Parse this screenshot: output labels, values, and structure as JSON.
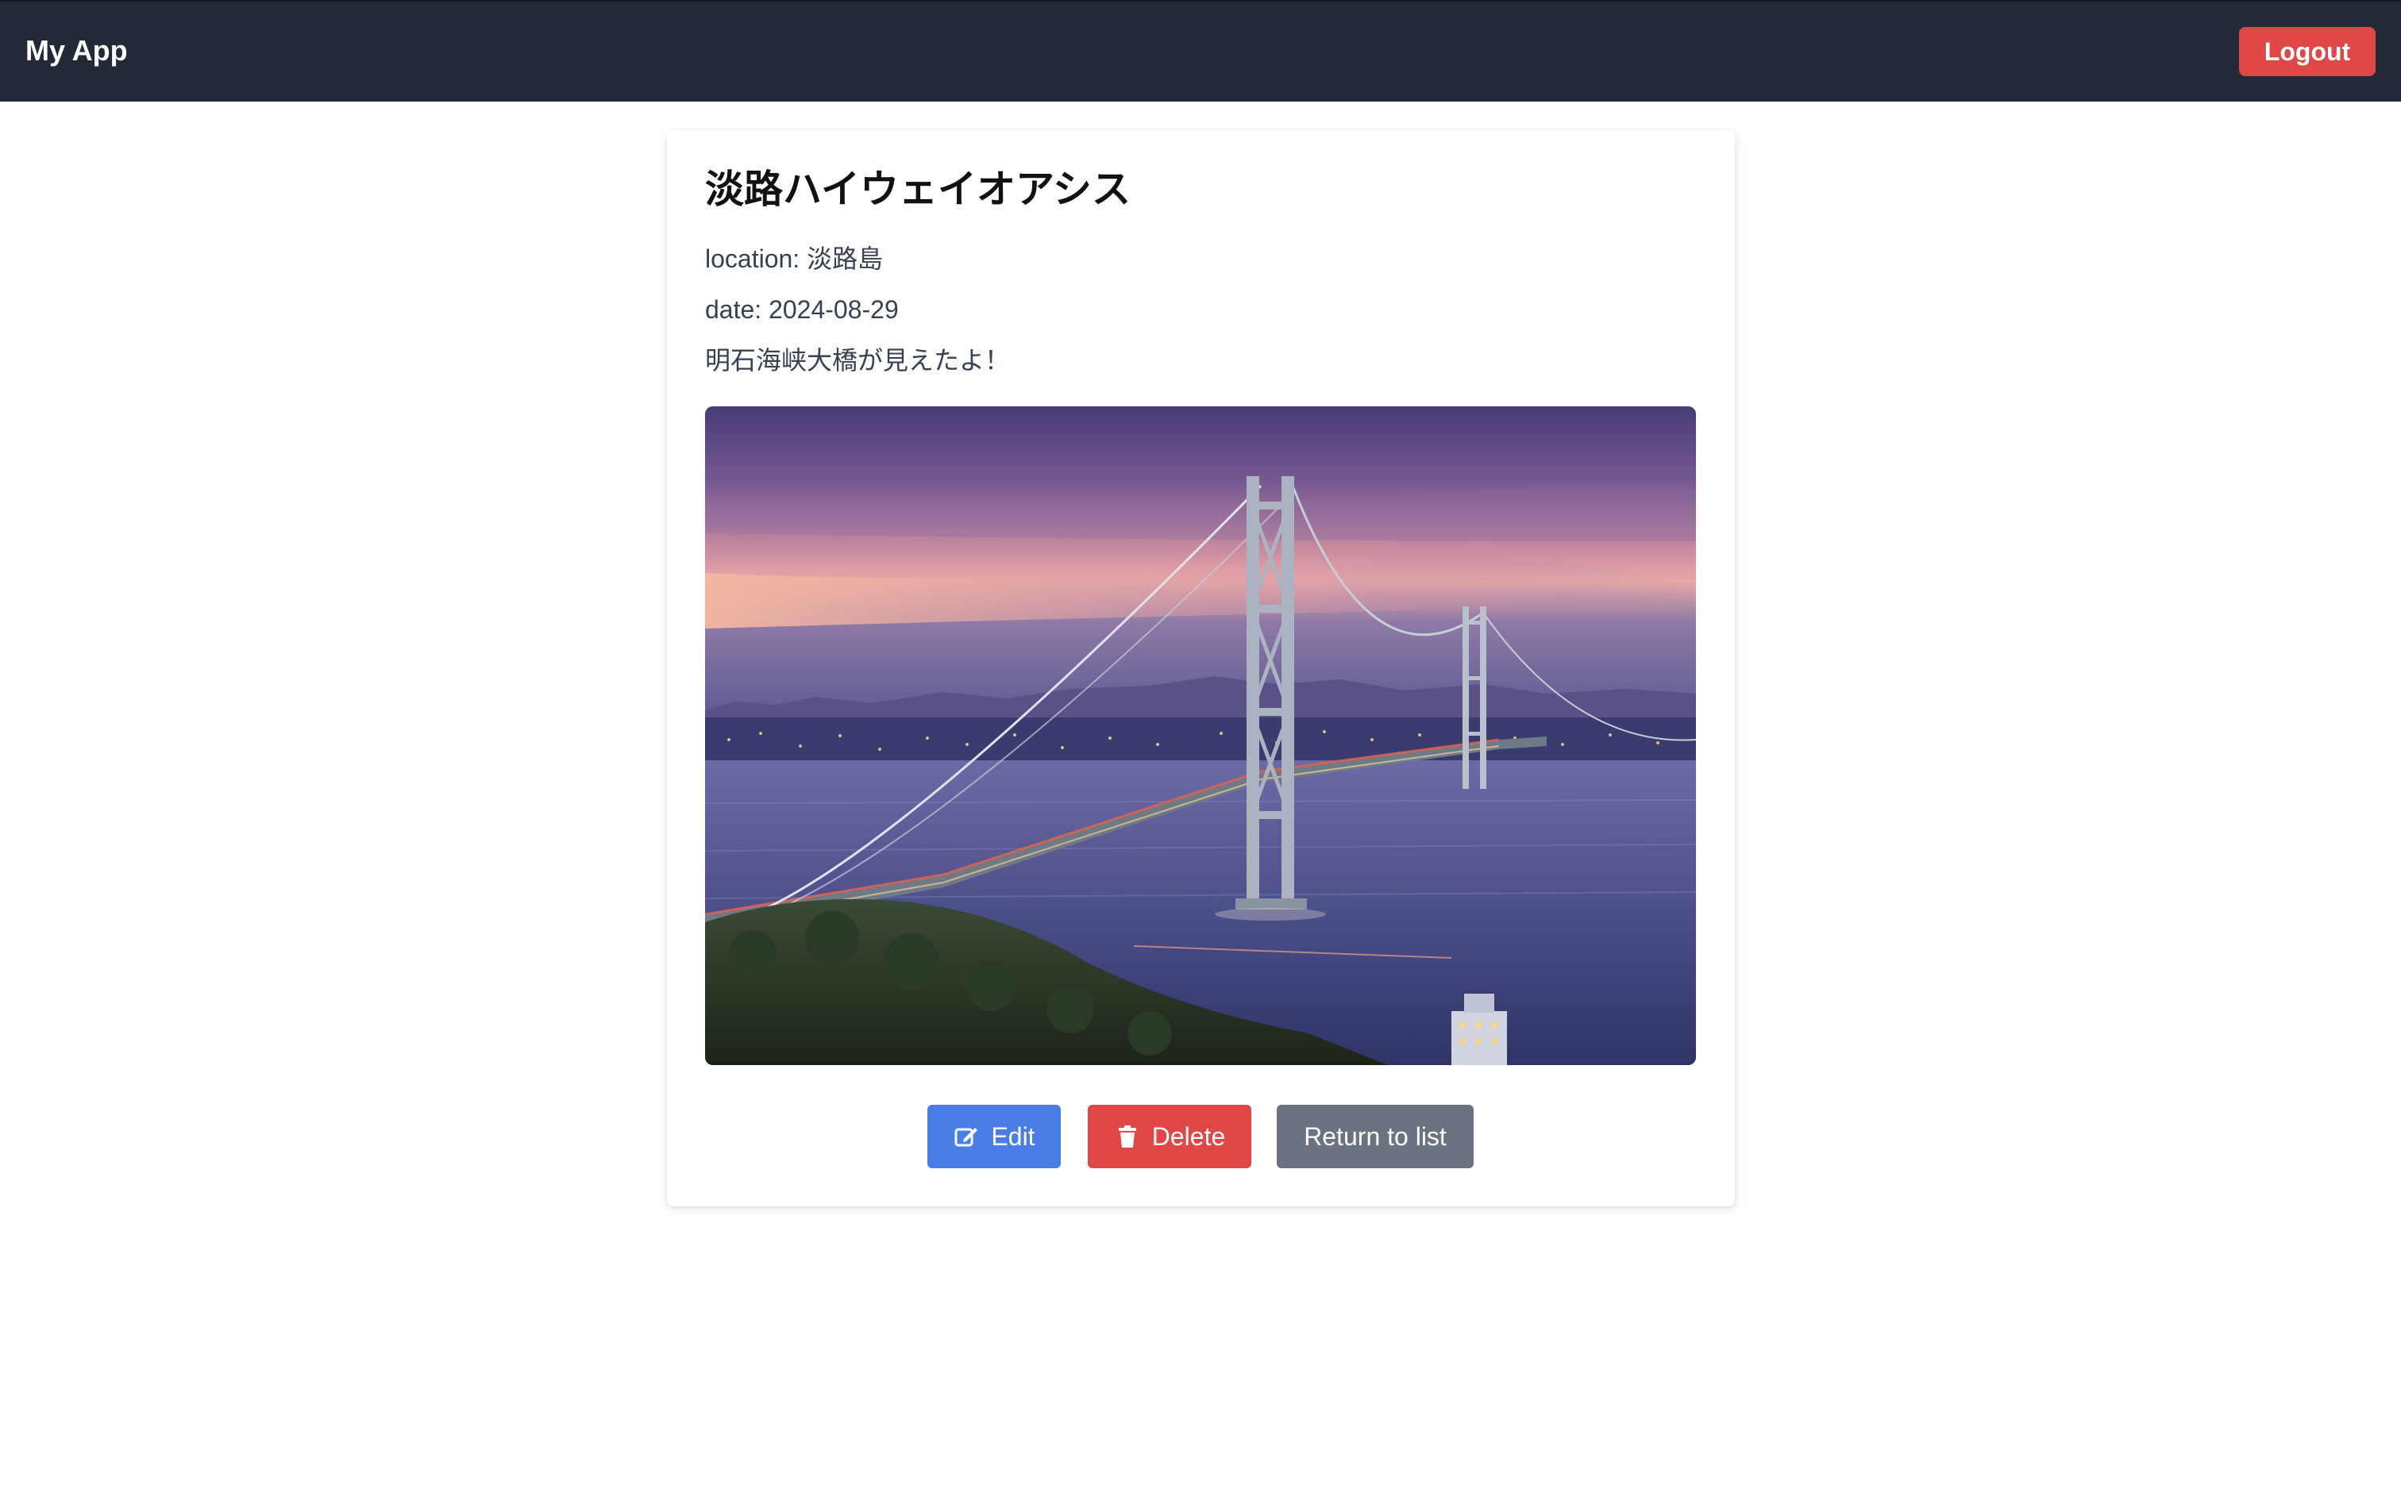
{
  "navbar": {
    "brand": "My App",
    "logout_label": "Logout",
    "logout_color": "#e04848",
    "background": "#232936"
  },
  "post": {
    "title": "淡路ハイウェイオアシス",
    "location_line": "location: 淡路島",
    "date_line": "date: 2024-08-29",
    "comment": "明石海峡大橋が見えたよ！",
    "photo": {
      "subject": "suspension bridge over a strait at dusk, purple sky, city lights on far shore, forested hill in foreground"
    }
  },
  "actions": {
    "edit_label": "Edit",
    "edit_icon": "edit-icon",
    "edit_color": "#4a7ee6",
    "delete_label": "Delete",
    "delete_icon": "trash-icon",
    "delete_color": "#e04848",
    "return_label": "Return to list",
    "return_color": "#6b7280"
  }
}
